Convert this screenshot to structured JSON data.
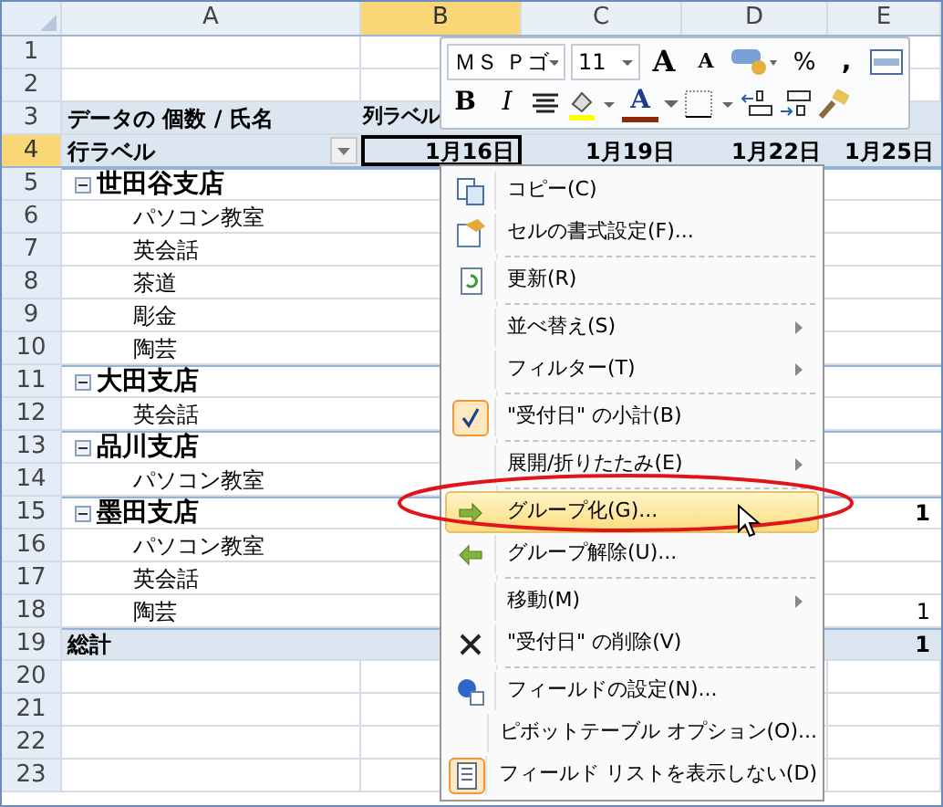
{
  "columns": [
    {
      "label": "A",
      "selected": false
    },
    {
      "label": "B",
      "selected": true
    },
    {
      "label": "C",
      "selected": false
    },
    {
      "label": "D",
      "selected": false
    },
    {
      "label": "E",
      "selected": false
    }
  ],
  "row_numbers": [
    {
      "label": "1",
      "selected": false
    },
    {
      "label": "2",
      "selected": false
    },
    {
      "label": "3",
      "selected": false
    },
    {
      "label": "4",
      "selected": true
    },
    {
      "label": "5",
      "selected": false
    },
    {
      "label": "6",
      "selected": false
    },
    {
      "label": "7",
      "selected": false
    },
    {
      "label": "8",
      "selected": false
    },
    {
      "label": "9",
      "selected": false
    },
    {
      "label": "10",
      "selected": false
    },
    {
      "label": "11",
      "selected": false
    },
    {
      "label": "12",
      "selected": false
    },
    {
      "label": "13",
      "selected": false
    },
    {
      "label": "14",
      "selected": false
    },
    {
      "label": "15",
      "selected": false
    },
    {
      "label": "16",
      "selected": false
    },
    {
      "label": "17",
      "selected": false
    },
    {
      "label": "18",
      "selected": false
    },
    {
      "label": "19",
      "selected": false
    },
    {
      "label": "20",
      "selected": false
    },
    {
      "label": "21",
      "selected": false
    },
    {
      "label": "22",
      "selected": false
    },
    {
      "label": "23",
      "selected": false
    }
  ],
  "pivot": {
    "value_label": "データの 個数 / 氏名",
    "column_label": "列ラベル",
    "row_label": "行ラベル",
    "dates": [
      "1月16日",
      "1月19日",
      "1月22日",
      "1月25日"
    ],
    "groups": [
      {
        "name": "世田谷支店",
        "expanded": true,
        "children": [
          {
            "name": "パソコン教室"
          },
          {
            "name": "英会話"
          },
          {
            "name": "茶道"
          },
          {
            "name": "彫金"
          },
          {
            "name": "陶芸"
          }
        ]
      },
      {
        "name": "大田支店",
        "expanded": true,
        "children": [
          {
            "name": "英会話"
          }
        ]
      },
      {
        "name": "品川支店",
        "expanded": true,
        "children": [
          {
            "name": "パソコン教室"
          }
        ]
      },
      {
        "name": "墨田支店",
        "expanded": true,
        "last_value": "1",
        "children": [
          {
            "name": "パソコン教室"
          },
          {
            "name": "英会話"
          },
          {
            "name": "陶芸",
            "last_value": "1"
          }
        ]
      }
    ],
    "total": {
      "label": "総計",
      "last_value": "1"
    }
  },
  "mini_toolbar": {
    "font": "ＭＳ Ｐゴ",
    "size": "11",
    "grow_font": "A",
    "shrink_font": "A",
    "percent": "%",
    "comma": ",",
    "bold": "B",
    "italic": "I",
    "font_color": "A"
  },
  "context_menu": [
    {
      "kind": "item",
      "label": "コピー(C)",
      "checked": false,
      "selected": false,
      "submenu": false
    },
    {
      "kind": "item",
      "label": "セルの書式設定(F)...",
      "checked": false,
      "selected": false,
      "submenu": false
    },
    {
      "kind": "separator"
    },
    {
      "kind": "item",
      "label": "更新(R)",
      "checked": false,
      "selected": false,
      "submenu": false
    },
    {
      "kind": "separator"
    },
    {
      "kind": "item",
      "label": "並べ替え(S)",
      "checked": false,
      "selected": false,
      "submenu": true
    },
    {
      "kind": "item",
      "label": "フィルター(T)",
      "checked": false,
      "selected": false,
      "submenu": true
    },
    {
      "kind": "separator"
    },
    {
      "kind": "item",
      "label": "\"受付日\" の小計(B)",
      "checked": true,
      "selected": false,
      "submenu": false
    },
    {
      "kind": "separator"
    },
    {
      "kind": "item",
      "label": "展開/折りたたみ(E)",
      "checked": false,
      "selected": false,
      "submenu": true
    },
    {
      "kind": "separator"
    },
    {
      "kind": "item",
      "label": "グループ化(G)...",
      "checked": false,
      "selected": true,
      "submenu": false
    },
    {
      "kind": "item",
      "label": "グループ解除(U)...",
      "checked": false,
      "selected": false,
      "submenu": false
    },
    {
      "kind": "separator"
    },
    {
      "kind": "item",
      "label": "移動(M)",
      "checked": false,
      "selected": false,
      "submenu": true
    },
    {
      "kind": "item",
      "label": "\"受付日\" の削除(V)",
      "checked": false,
      "selected": false,
      "submenu": false
    },
    {
      "kind": "separator"
    },
    {
      "kind": "item",
      "label": "フィールドの設定(N)...",
      "checked": false,
      "selected": false,
      "submenu": false
    },
    {
      "kind": "item",
      "label": "ピボットテーブル オプション(O)...",
      "checked": false,
      "selected": false,
      "submenu": false
    },
    {
      "kind": "item",
      "label": "フィールド リストを表示しない(D)",
      "checked": true,
      "selected": false,
      "submenu": false
    }
  ]
}
